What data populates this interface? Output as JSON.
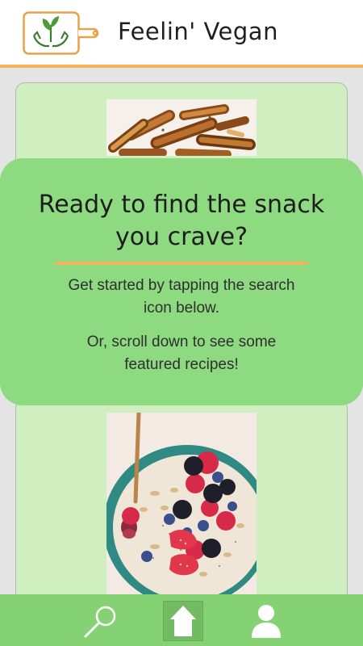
{
  "header": {
    "app_title": "Feelin' Vegan",
    "logo_icon": "vegan-hands-sprout-icon"
  },
  "colors": {
    "accent_orange": "#f2b25e",
    "overlay_green": "#8dda81",
    "card_green": "#d0efc1",
    "nav_green": "#85d274"
  },
  "overlay": {
    "title_line1": "Ready to find the snack",
    "title_line2": "you crave?",
    "text_line1": "Get started by tapping the search",
    "text_line2": "icon below.",
    "text_line3": "Or, scroll down to see some",
    "text_line4": "featured recipes!"
  },
  "recipes": [
    {
      "image": "roasted-potato-wedges-photo"
    },
    {
      "image": "berry-smoothie-bowl-photo"
    }
  ],
  "bottom_nav": {
    "items": [
      {
        "icon": "search-icon",
        "active": false
      },
      {
        "icon": "home-icon",
        "active": true
      },
      {
        "icon": "user-icon",
        "active": false
      }
    ]
  }
}
